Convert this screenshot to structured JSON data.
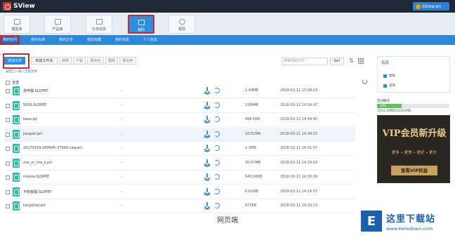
{
  "app": {
    "title": "SView",
    "user": "SView.en"
  },
  "nav": {
    "tabs": [
      {
        "label": "模型库"
      },
      {
        "label": "产品库"
      },
      {
        "label": "分享动态"
      },
      {
        "label": "我的"
      },
      {
        "label": "帮助"
      }
    ]
  },
  "subnav": {
    "items": [
      {
        "label": "我的空间"
      },
      {
        "label": "我的标准"
      },
      {
        "label": "我的分享"
      },
      {
        "label": "我的收藏"
      },
      {
        "label": "我的消息"
      },
      {
        "label": "个人信息"
      }
    ]
  },
  "toolbar": {
    "upload": "添加文件",
    "new_folder": "新建文件夹",
    "share": "转换",
    "download": "下载",
    "rename": "重命名",
    "delete": "删除",
    "move": "移动到",
    "search_placeholder": "搜索您的文件",
    "go": "Go!"
  },
  "breadcrumb": {
    "back": "返回上一级",
    "sep": " | ",
    "all": "全部文件"
  },
  "list": {
    "select_all": "全选",
    "rows": [
      {
        "name": "排声器.SLDPRT",
        "dash": "-",
        "size": "1.49MB",
        "date": "2018-02-11 15:08:03"
      },
      {
        "name": "5555.SLDPRT",
        "dash": "-",
        "size": "3.86MB",
        "date": "2018-02-11 14:54:37"
      },
      {
        "name": "base.ipt",
        "dash": "-",
        "size": "498.5KB",
        "date": "2018-02-11 14:49:40"
      },
      {
        "name": "jianpan.prt",
        "dash": "-",
        "size": "10.61MB",
        "date": "2018-02-11 14:34:22"
      },
      {
        "name": "20170319-200645-37000.catpart",
        "dash": "-",
        "size": "1.3MB",
        "date": "2018-02-11 14:31:07"
      },
      {
        "name": "zuo_yi_cha_ji.prt",
        "dash": "-",
        "size": "30.07MB",
        "date": "2018-02-11 14:23:03"
      },
      {
        "name": "mouse.SLDPRT",
        "dash": "-",
        "size": "643.06KB",
        "date": "2018-02-11 14:16:18"
      },
      {
        "name": "平衡板翻.SLDPRT",
        "dash": "-",
        "size": "6.61MB",
        "date": "2018-02-11 14:14:07"
      },
      {
        "name": "tangshao.prt",
        "dash": "-",
        "size": "972KB",
        "date": "2018-02-11 14:10:13"
      }
    ]
  },
  "sidebar": {
    "title": "指南",
    "items": [
      {
        "label": "帮助"
      },
      {
        "label": "咨询"
      }
    ],
    "capacity_label": "空间概况",
    "capacity_percent": "34%",
    "capacity_value": 0.34,
    "capacity_text": "3503.39MB/10352MB"
  },
  "vip": {
    "title": "VIP会员新升级",
    "sub": "更多 • 更快 • 更好 • 更大",
    "button": "查看VIP权益"
  },
  "caption": "网页端",
  "watermark": {
    "cn": "这里下载站",
    "url": "www.Heredown.com",
    "logo": "E"
  }
}
